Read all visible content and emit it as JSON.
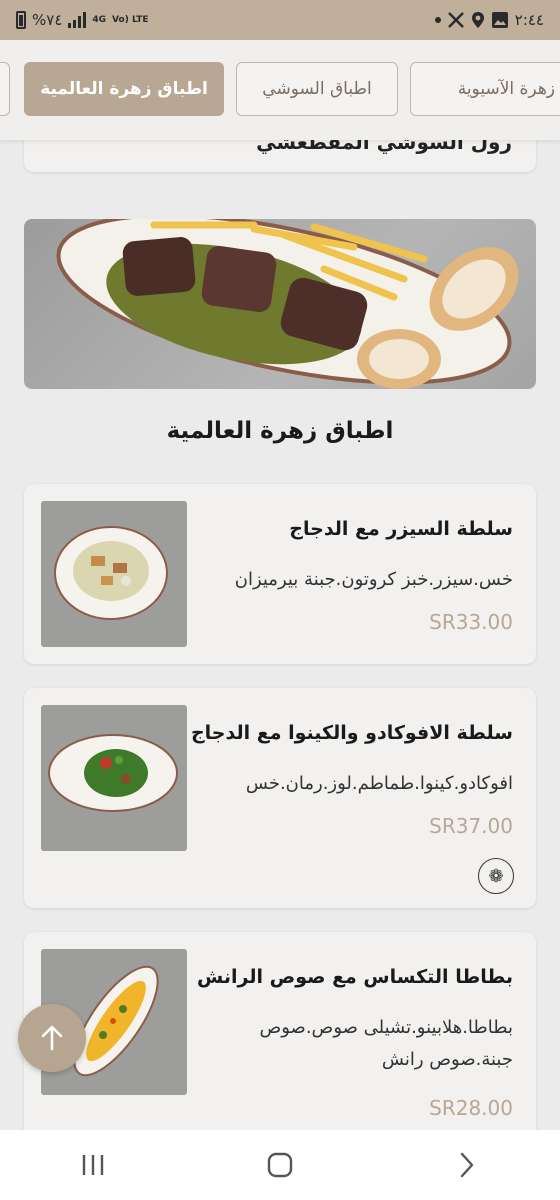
{
  "status_bar": {
    "battery_percent": "%٧٤",
    "network": "4G",
    "volte": "Vo) LTE",
    "time": "٢:٤٤"
  },
  "tabs": [
    {
      "label": "اطباق زهرة العالمية",
      "active": true
    },
    {
      "label": "اطباق السوشي",
      "active": false
    },
    {
      "label": "زهرة الآسيوية",
      "active": false
    }
  ],
  "previous_item_partial": "رول السوشي المقطعشي",
  "section": {
    "title": "اطباق زهرة العالمية"
  },
  "items": [
    {
      "name": "سلطة السيزر مع الدجاج",
      "description": "خس.سيزر.خبز كروتون.جبنة بيرميزان",
      "price": "SR33.00"
    },
    {
      "name": "سلطة الافوكادو والكينوا مع الدجاج",
      "description": "افوكادو.كينوا.طماطم.لوز.رمان.خس",
      "price": "SR37.00",
      "badge_icon": "vegetarian-icon"
    },
    {
      "name": "بطاطا التكساس مع صوص الرانش",
      "description": "بطاطا.هلابينو.تشيلى صوص.صوص جبنة.صوص رانش",
      "price": "SR28.00"
    }
  ],
  "icons": {
    "fab": "arrow-up-icon",
    "nav": [
      "recent-apps-icon",
      "home-icon",
      "back-icon"
    ]
  },
  "colors": {
    "accent": "#b8a793",
    "status_bar": "#bfaf9b",
    "price": "#b7a793"
  }
}
